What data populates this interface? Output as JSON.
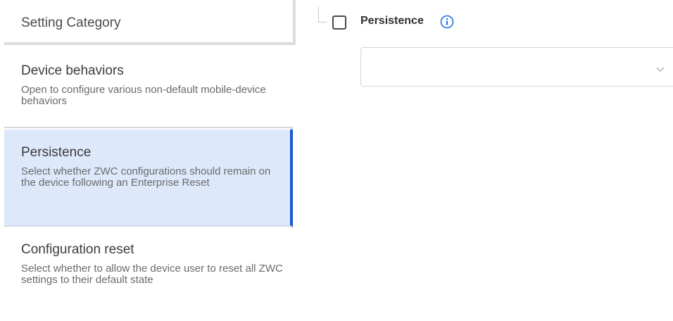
{
  "sidebar": {
    "header": "Setting Category",
    "items": [
      {
        "title": "Device behaviors",
        "description": "Open to configure various non-default mobile-device behaviors",
        "selected": false
      },
      {
        "title": "Persistence",
        "description": "Select whether ZWC configurations should remain on the device following an Enterprise Reset",
        "selected": true
      },
      {
        "title": "Configuration reset",
        "description": "Select whether to allow the device user to reset all ZWC settings to their default state",
        "selected": false
      }
    ]
  },
  "panel": {
    "setting_label": "Persistence",
    "checkbox_checked": false,
    "dropdown_value": ""
  },
  "colors": {
    "selected_bg": "#dde8fb",
    "accent": "#1a56d6"
  },
  "icons": {
    "info": "info-icon",
    "dropdown": "chevron-down-icon"
  }
}
